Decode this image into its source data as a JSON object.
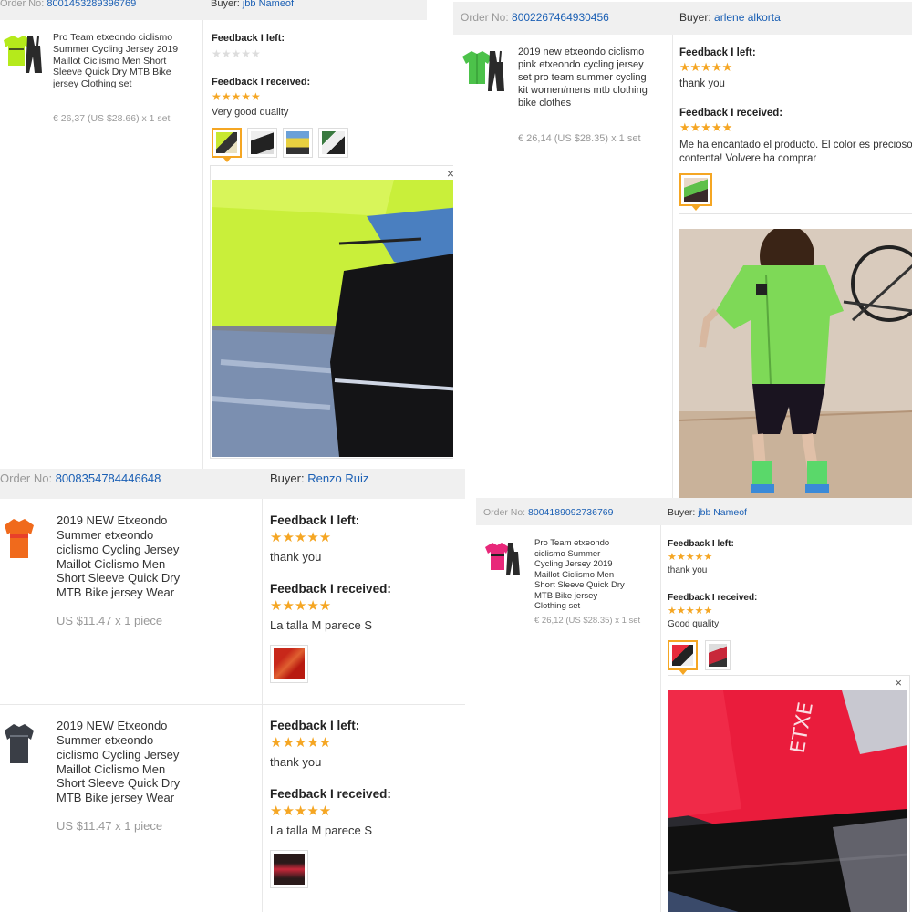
{
  "colors": {
    "link": "#1a5fb4",
    "star": "#f5a623",
    "header_bg": "#f0f0f0"
  },
  "icons": {
    "star": "★",
    "close": "close-icon"
  },
  "orders": [
    {
      "order_label": "Order No:",
      "order_no": "8001453289396769",
      "buyer_label": "Buyer:",
      "buyer": "jbb Nameof",
      "product_title": "Pro Team etxeondo ciclismo Summer Cycling Jersey 2019 Maillot Ciclismo Men Short Sleeve Quick Dry MTB Bike jersey Clothing set",
      "price": "€ 26,37 (US $28.66) x 1 set",
      "fb_left_label": "Feedback I left:",
      "fb_left_stars": "★★★★★",
      "fb_received_label": "Feedback I received:",
      "fb_received_stars": "★★★★★",
      "fb_received_text": "Very good quality",
      "close": "×"
    },
    {
      "order_label": "Order No:",
      "order_no": "8002267464930456",
      "buyer_label": "Buyer:",
      "buyer": "arlene alkorta",
      "product_title": "2019 new etxeondo ciclismo pink etxeondo cycling jersey set pro team summer cycling kit women/mens mtb clothing bike clothes",
      "price": "€ 26,14 (US $28.35) x 1 set",
      "fb_left_label": "Feedback I left:",
      "fb_left_stars": "★★★★★",
      "fb_left_text": "thank you",
      "fb_received_label": "Feedback I received:",
      "fb_received_stars": "★★★★★",
      "fb_received_text": "Me ha encantado el producto. El color es precioso contenta! Volvere ha comprar"
    },
    {
      "order_label": "Order No:",
      "order_no": "8008354784446648",
      "buyer_label": "Buyer:",
      "buyer": "Renzo Ruiz",
      "items": [
        {
          "product_title": "2019 NEW Etxeondo Summer etxeondo ciclismo Cycling Jersey Maillot Ciclismo Men Short Sleeve Quick Dry MTB Bike jersey Wear",
          "price": "US $11.47 x 1 piece",
          "fb_left_label": "Feedback I left:",
          "fb_left_stars": "★★★★★",
          "fb_left_text": "thank you",
          "fb_received_label": "Feedback I received:",
          "fb_received_stars": "★★★★★",
          "fb_received_text": "La talla M parece S"
        },
        {
          "product_title": "2019 NEW Etxeondo Summer etxeondo ciclismo Cycling Jersey Maillot Ciclismo Men Short Sleeve Quick Dry MTB Bike jersey Wear",
          "price": "US $11.47 x 1 piece",
          "fb_left_label": "Feedback I left:",
          "fb_left_stars": "★★★★★",
          "fb_left_text": "thank you",
          "fb_received_label": "Feedback I received:",
          "fb_received_stars": "★★★★★",
          "fb_received_text": "La talla M parece S"
        }
      ]
    },
    {
      "order_label": "Order No:",
      "order_no": "8004189092736769",
      "buyer_label": "Buyer:",
      "buyer": "jbb Nameof",
      "product_title": "Pro Team etxeondo ciclismo Summer Cycling Jersey 2019 Maillot Ciclismo Men Short Sleeve Quick Dry MTB Bike jersey Clothing set",
      "price": "€ 26,12 (US $28.35) x 1 set",
      "fb_left_label": "Feedback I left:",
      "fb_left_stars": "★★★★★",
      "fb_left_text": "thank you",
      "fb_received_label": "Feedback I received:",
      "fb_received_stars": "★★★★★",
      "fb_received_text": "Good quality",
      "close": "×"
    }
  ]
}
